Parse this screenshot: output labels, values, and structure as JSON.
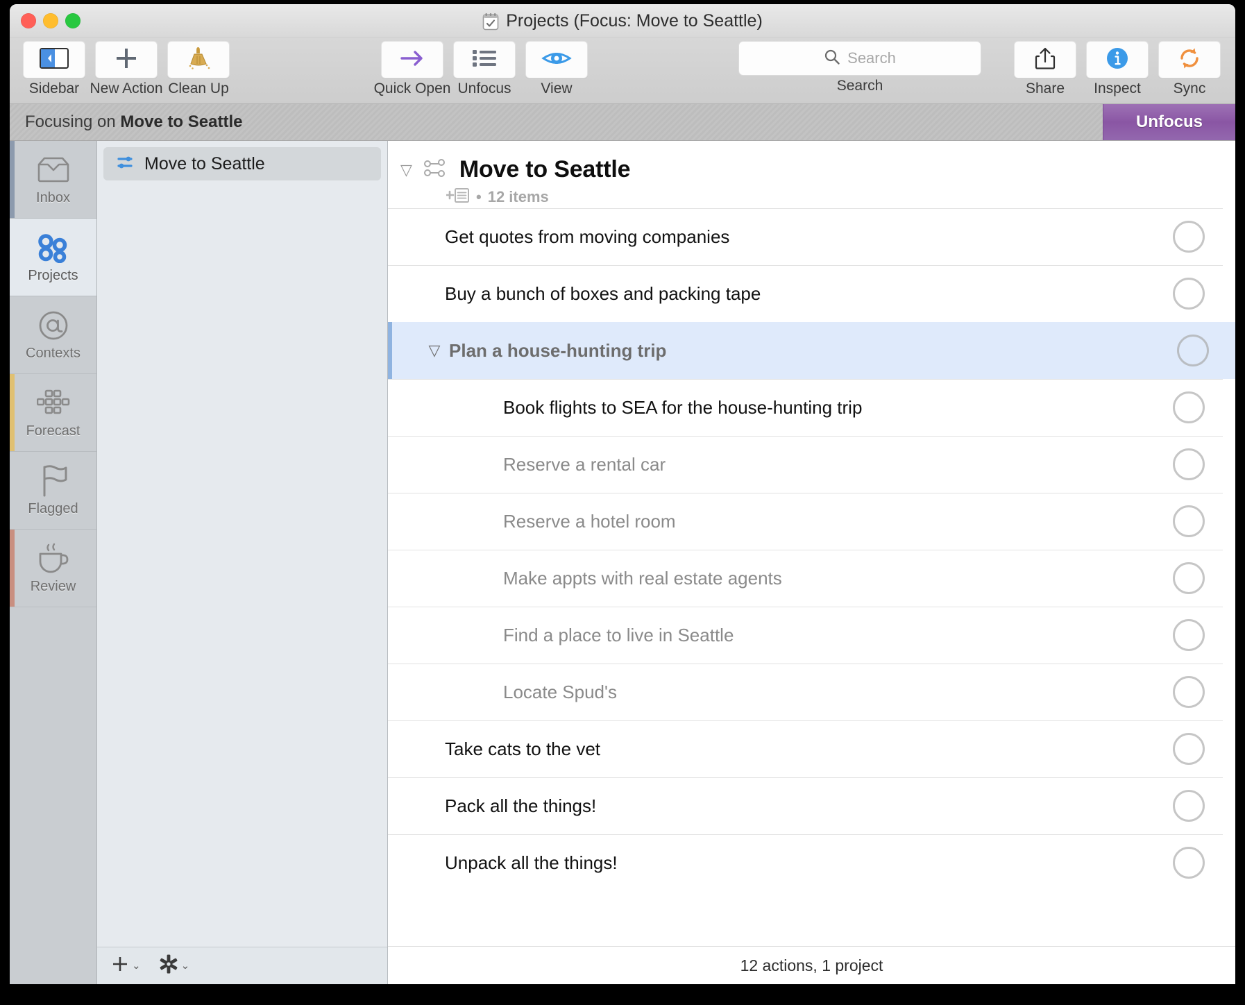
{
  "window": {
    "title": "Projects (Focus: Move to Seattle)",
    "doc_icon": "omnifocus-document-icon",
    "traffic_lights": [
      "close-button",
      "minimize-button",
      "zoom-button"
    ]
  },
  "toolbar": {
    "left_items": [
      {
        "label": "Sidebar",
        "icon": "sidebar-toggle-icon"
      },
      {
        "label": "New Action",
        "icon": "plus-icon"
      },
      {
        "label": "Clean Up",
        "icon": "broom-icon"
      }
    ],
    "center_items": [
      {
        "label": "Quick Open",
        "icon": "arrow-right-icon"
      },
      {
        "label": "Unfocus",
        "icon": "list-bullets-icon"
      },
      {
        "label": "View",
        "icon": "eye-icon"
      }
    ],
    "search": {
      "group_label": "Search",
      "placeholder": "Search",
      "value": "",
      "icon": "search-icon"
    },
    "right_items": [
      {
        "label": "Share",
        "icon": "share-icon"
      },
      {
        "label": "Inspect",
        "icon": "info-circle-icon"
      },
      {
        "label": "Sync",
        "icon": "sync-refresh-icon"
      }
    ]
  },
  "focus_bar": {
    "prefix": "Focusing on ",
    "target": "Move to Seattle",
    "unfocus_label": "Unfocus",
    "accent_color": "#8a56a4"
  },
  "sidebar": {
    "items": [
      {
        "label": "Inbox",
        "icon": "inbox-tray-icon",
        "accent": "#8c9aad",
        "selected": false
      },
      {
        "label": "Projects",
        "icon": "projects-dots-icon",
        "accent": "#e4e9ee",
        "selected": true
      },
      {
        "label": "Contexts",
        "icon": "at-sign-icon",
        "accent": "#c9cdd1",
        "selected": false
      },
      {
        "label": "Forecast",
        "icon": "calendar-grid-icon",
        "accent": "#e0c071",
        "selected": false
      },
      {
        "label": "Flagged",
        "icon": "flag-icon",
        "accent": "#c9cdd1",
        "selected": false
      },
      {
        "label": "Review",
        "icon": "coffee-cup-icon",
        "accent": "#c98f80",
        "selected": false
      }
    ]
  },
  "project_list": {
    "rows": [
      {
        "title": "Move to Seattle",
        "icon": "parallel-project-icon",
        "selected": true
      }
    ],
    "footer": {
      "add_label": "add-menu",
      "add_icon": "plus-icon",
      "action_label": "action-menu",
      "action_icon": "gear-icon",
      "caret": "⌄"
    }
  },
  "outline": {
    "header": {
      "title": "Move to Seattle",
      "disclosure": "▽",
      "project_icon": "parallel-project-icon",
      "note_icon": "add-note-icon",
      "bullet": "•",
      "count_text": "12 items"
    },
    "rows": [
      {
        "text": "Get quotes from moving companies",
        "level": 0,
        "dim": false,
        "group": false,
        "selected": false,
        "disclosure": ""
      },
      {
        "text": "Buy a bunch of boxes and packing tape",
        "level": 0,
        "dim": false,
        "group": false,
        "selected": false,
        "disclosure": ""
      },
      {
        "text": "Plan a house-hunting trip",
        "level": 0,
        "dim": false,
        "group": true,
        "selected": true,
        "disclosure": "▽"
      },
      {
        "text": "Book flights to SEA for the house-hunting trip",
        "level": 1,
        "dim": false,
        "group": false,
        "selected": false,
        "disclosure": ""
      },
      {
        "text": "Reserve a rental car",
        "level": 1,
        "dim": true,
        "group": false,
        "selected": false,
        "disclosure": ""
      },
      {
        "text": "Reserve a hotel room",
        "level": 1,
        "dim": true,
        "group": false,
        "selected": false,
        "disclosure": ""
      },
      {
        "text": "Make appts with real estate agents",
        "level": 1,
        "dim": true,
        "group": false,
        "selected": false,
        "disclosure": ""
      },
      {
        "text": "Find a place to live in Seattle",
        "level": 1,
        "dim": true,
        "group": false,
        "selected": false,
        "disclosure": ""
      },
      {
        "text": "Locate Spud's",
        "level": 1,
        "dim": true,
        "group": false,
        "selected": false,
        "disclosure": ""
      },
      {
        "text": "Take cats to the vet",
        "level": 0,
        "dim": false,
        "group": false,
        "selected": false,
        "disclosure": ""
      },
      {
        "text": "Pack all the things!",
        "level": 0,
        "dim": false,
        "group": false,
        "selected": false,
        "disclosure": ""
      },
      {
        "text": "Unpack all the things!",
        "level": 0,
        "dim": false,
        "group": false,
        "selected": false,
        "disclosure": ""
      }
    ]
  },
  "status_bar": {
    "text": "12 actions, 1 project"
  }
}
